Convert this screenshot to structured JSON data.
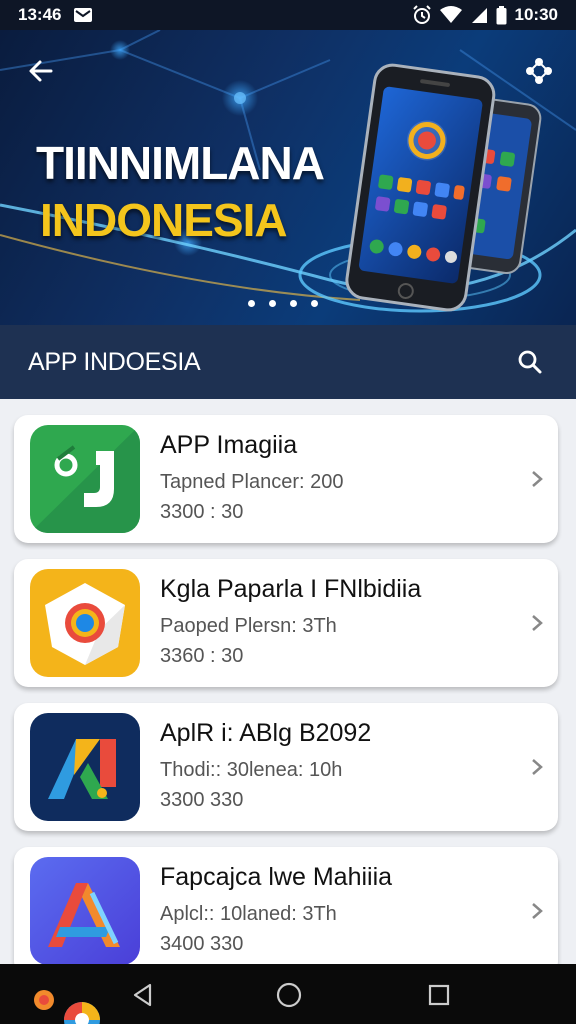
{
  "status_bar": {
    "time_left": "13:46",
    "time_right": "10:30",
    "icons": [
      "mail-icon",
      "alarm-icon",
      "wifi-icon",
      "signal-icon",
      "battery-icon"
    ]
  },
  "hero": {
    "title_line1": "TIINNIMLANA",
    "title_line2": "INDONESIA",
    "page_dots": 4,
    "back_icon": "arrow-left-icon",
    "share_icon": "share-icon"
  },
  "section": {
    "title": "APP INDOESIA",
    "search_icon": "search-icon"
  },
  "apps": [
    {
      "name": "APP Imagiia",
      "meta1": "Tapned Plancer: 200",
      "meta2": "3300 : 30",
      "icon": "green-app-icon"
    },
    {
      "name": "Kgla Paparla I FNlbidiia",
      "meta1": "Paoped Plersn: 3Th",
      "meta2": "3360 : 30",
      "icon": "yellow-app-icon"
    },
    {
      "name": "AplR i: ABlg B2092",
      "meta1": "Thodi:: 30lenea: 10h",
      "meta2": "3300 330",
      "icon": "navy-app-icon"
    },
    {
      "name": "Fapcajca lwe Mahiiia",
      "meta1": "Aplcl:: 10laned: 3Th",
      "meta2": "3400 330",
      "icon": "purple-app-icon"
    }
  ],
  "colors": {
    "header_bg": "#1e3152",
    "accent_yellow": "#f4c51c",
    "hero_bg": "#0f2f63"
  }
}
